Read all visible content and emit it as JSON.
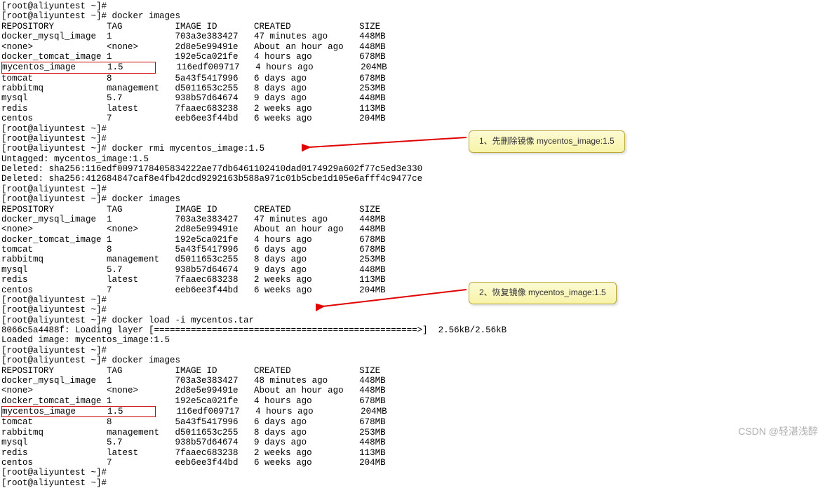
{
  "prompt": "[root@aliyuntest ~]# ",
  "commands": {
    "docker_images": "docker images",
    "docker_rmi": "docker rmi mycentos_image:1.5",
    "docker_load": "docker load -i mycentos.tar"
  },
  "header": "REPOSITORY          TAG          IMAGE ID       CREATED             SIZE",
  "images_1": [
    "docker_mysql_image  1            703a3e383427   47 minutes ago      448MB",
    "<none>              <none>       2d8e5e99491e   About an hour ago   448MB",
    "docker_tomcat_image 1            192e5ca021fe   4 hours ago         678MB"
  ],
  "highlight_1": "mycentos_image      1.5      ",
  "highlight_1_rest": "    116edf009717   4 hours ago         204MB",
  "images_1b": [
    "tomcat              8            5a43f5417996   6 days ago          678MB",
    "rabbitmq            management   d5011653c255   8 days ago          253MB",
    "mysql               5.7          938b57d64674   9 days ago          448MB",
    "redis               latest       7faaec683238   2 weeks ago         113MB",
    "centos              7            eeb6ee3f44bd   6 weeks ago         204MB"
  ],
  "rmi_output": [
    "Untagged: mycentos_image:1.5",
    "Deleted: sha256:116edf0097178405834222ae77db6461102410dad0174929a602f77c5ed3e330",
    "Deleted: sha256:412684847caf8e4fb42dcd9292163b588a971c01b5cbe1d105e6afff4c9477ce"
  ],
  "images_2": [
    "REPOSITORY          TAG          IMAGE ID       CREATED             SIZE",
    "docker_mysql_image  1            703a3e383427   47 minutes ago      448MB",
    "<none>              <none>       2d8e5e99491e   About an hour ago   448MB",
    "docker_tomcat_image 1            192e5ca021fe   4 hours ago         678MB",
    "tomcat              8            5a43f5417996   6 days ago          678MB",
    "rabbitmq            management   d5011653c255   8 days ago          253MB",
    "mysql               5.7          938b57d64674   9 days ago          448MB",
    "redis               latest       7faaec683238   2 weeks ago         113MB",
    "centos              7            eeb6ee3f44bd   6 weeks ago         204MB"
  ],
  "load_output": [
    "8066c5a4488f: Loading layer [==================================================>]  2.56kB/2.56kB",
    "Loaded image: mycentos_image:1.5"
  ],
  "images_3": [
    "REPOSITORY          TAG          IMAGE ID       CREATED             SIZE",
    "docker_mysql_image  1            703a3e383427   48 minutes ago      448MB",
    "<none>              <none>       2d8e5e99491e   About an hour ago   448MB",
    "docker_tomcat_image 1            192e5ca021fe   4 hours ago         678MB"
  ],
  "highlight_3": "mycentos_image      1.5      ",
  "highlight_3_rest": "    116edf009717   4 hours ago         204MB",
  "images_3b": [
    "tomcat              8            5a43f5417996   6 days ago          678MB",
    "rabbitmq            management   d5011653c255   8 days ago          253MB",
    "mysql               5.7          938b57d64674   9 days ago          448MB",
    "redis               latest       7faaec683238   2 weeks ago         113MB",
    "centos              7            eeb6ee3f44bd   6 weeks ago         204MB"
  ],
  "callouts": {
    "c1": "1、先删除镜像 mycentos_image:1.5",
    "c2": "2、恢复镜像 mycentos_image:1.5"
  },
  "watermark": "CSDN @轻湛浅醉"
}
